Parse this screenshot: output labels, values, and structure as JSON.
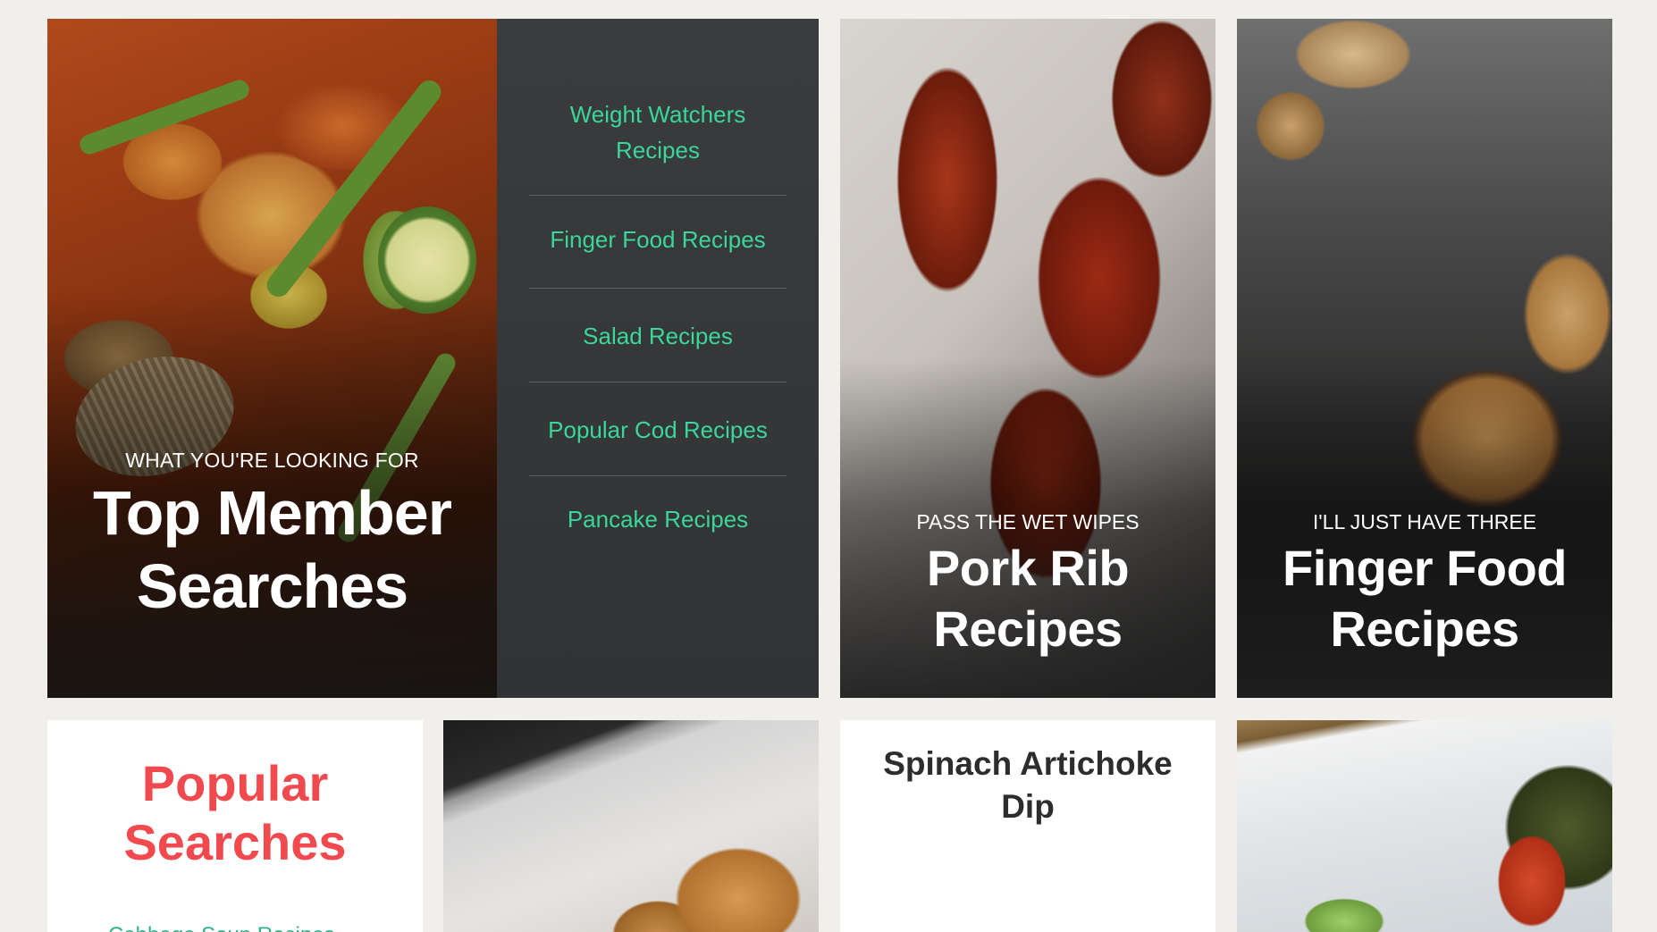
{
  "hero": {
    "eyebrow": "WHAT YOU'RE LOOKING FOR",
    "title": "Top Member Searches",
    "links": [
      "Weight Watchers Recipes",
      "Finger Food Recipes",
      "Salad Recipes",
      "Popular Cod Recipes",
      "Pancake Recipes"
    ]
  },
  "cards": {
    "pork_rib": {
      "eyebrow": "PASS THE WET WIPES",
      "title": "Pork Rib Recipes"
    },
    "finger_food": {
      "eyebrow": "I'LL JUST HAVE THREE",
      "title": "Finger Food Recipes"
    }
  },
  "bottom": {
    "popular": {
      "title": "Popular Searches",
      "peek_link": "Cabbage Soup Recipes"
    },
    "spinach": {
      "title": "Spinach Artichoke Dip"
    }
  },
  "colors": {
    "background": "#f0efeb",
    "link_green": "#3ad69a",
    "accent_red": "#f04a4f",
    "panel_dark": "#2f3133"
  }
}
